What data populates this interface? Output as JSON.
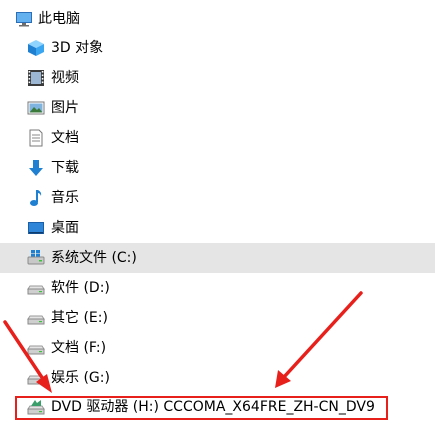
{
  "tree": {
    "root": {
      "label": "此电脑",
      "icon": "computer-icon"
    },
    "items": [
      {
        "label": "3D 对象",
        "icon": "3d-objects-icon"
      },
      {
        "label": "视频",
        "icon": "video-icon"
      },
      {
        "label": "图片",
        "icon": "pictures-icon"
      },
      {
        "label": "文档",
        "icon": "documents-icon"
      },
      {
        "label": "下载",
        "icon": "download-icon"
      },
      {
        "label": "音乐",
        "icon": "music-icon"
      },
      {
        "label": "桌面",
        "icon": "desktop-icon"
      },
      {
        "label": "系统文件 (C:)",
        "icon": "windows-drive-icon"
      },
      {
        "label": "软件 (D:)",
        "icon": "drive-icon"
      },
      {
        "label": "其它 (E:)",
        "icon": "drive-icon"
      },
      {
        "label": "文档 (F:)",
        "icon": "drive-icon"
      },
      {
        "label": "娱乐 (G:)",
        "icon": "drive-icon"
      },
      {
        "label": "DVD 驱动器 (H:) CCCOMA_X64FRE_ZH-CN_DV9",
        "icon": "dvd-drive-icon"
      }
    ]
  },
  "colors": {
    "highlight_bg": "#e5e5e5",
    "annotation_red": "#e8201c"
  }
}
